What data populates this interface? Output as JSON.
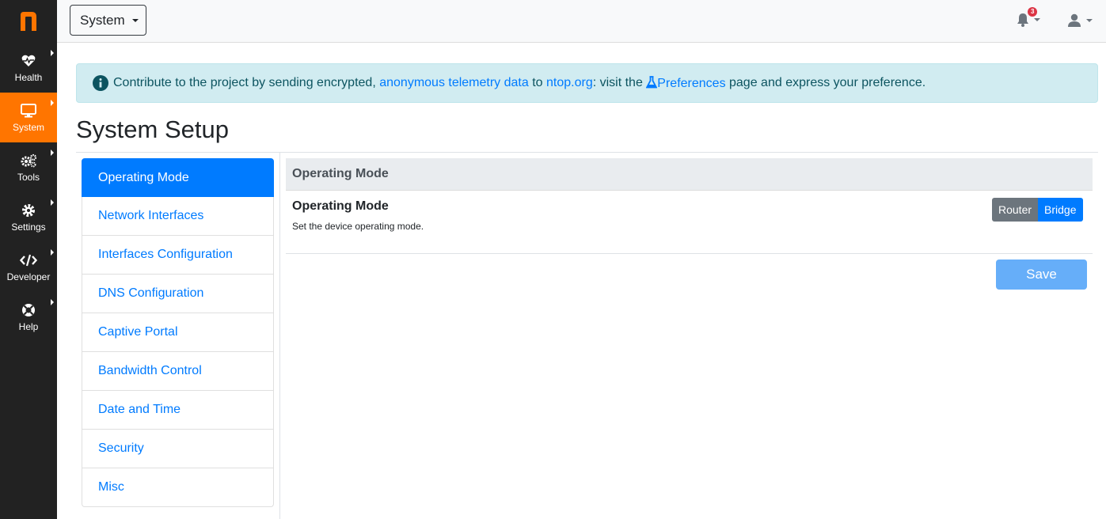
{
  "colors": {
    "brand_orange": "#ff7500",
    "sidebar_bg": "#222222",
    "primary_blue": "#007bff",
    "alert_bg": "#d1ecf1",
    "badge_red": "#dc3545"
  },
  "sidebar": {
    "logo_icon": "ntop-logo",
    "items": [
      {
        "label": "Health",
        "icon": "heartbeat-icon",
        "active": false
      },
      {
        "label": "System",
        "icon": "desktop-icon",
        "active": true
      },
      {
        "label": "Tools",
        "icon": "cogs-icon",
        "active": false
      },
      {
        "label": "Settings",
        "icon": "gear-icon",
        "active": false
      },
      {
        "label": "Developer",
        "icon": "code-icon",
        "active": false
      },
      {
        "label": "Help",
        "icon": "life-ring-icon",
        "active": false
      }
    ]
  },
  "topbar": {
    "system_dropdown": "System",
    "notifications_count": "3",
    "bell_icon": "bell-icon",
    "user_icon": "user-icon"
  },
  "alert": {
    "text_before": "Contribute to the project by sending encrypted, ",
    "link_telemetry": "anonymous telemetry data",
    "text_to": " to ",
    "link_ntop": "ntop.org",
    "text_visit": ": visit the ",
    "link_preferences": "Preferences",
    "text_after": " page and express your preference."
  },
  "page": {
    "title": "System Setup"
  },
  "tabs": [
    {
      "label": "Operating Mode",
      "active": true
    },
    {
      "label": "Network Interfaces",
      "active": false
    },
    {
      "label": "Interfaces Configuration",
      "active": false
    },
    {
      "label": "DNS Configuration",
      "active": false
    },
    {
      "label": "Captive Portal",
      "active": false
    },
    {
      "label": "Bandwidth Control",
      "active": false
    },
    {
      "label": "Date and Time",
      "active": false
    },
    {
      "label": "Security",
      "active": false
    },
    {
      "label": "Misc",
      "active": false
    }
  ],
  "panel": {
    "header": "Operating Mode",
    "setting_title": "Operating Mode",
    "setting_description": "Set the device operating mode.",
    "options": [
      "Router",
      "Bridge"
    ],
    "selected_option": "Bridge",
    "save_label": "Save"
  }
}
